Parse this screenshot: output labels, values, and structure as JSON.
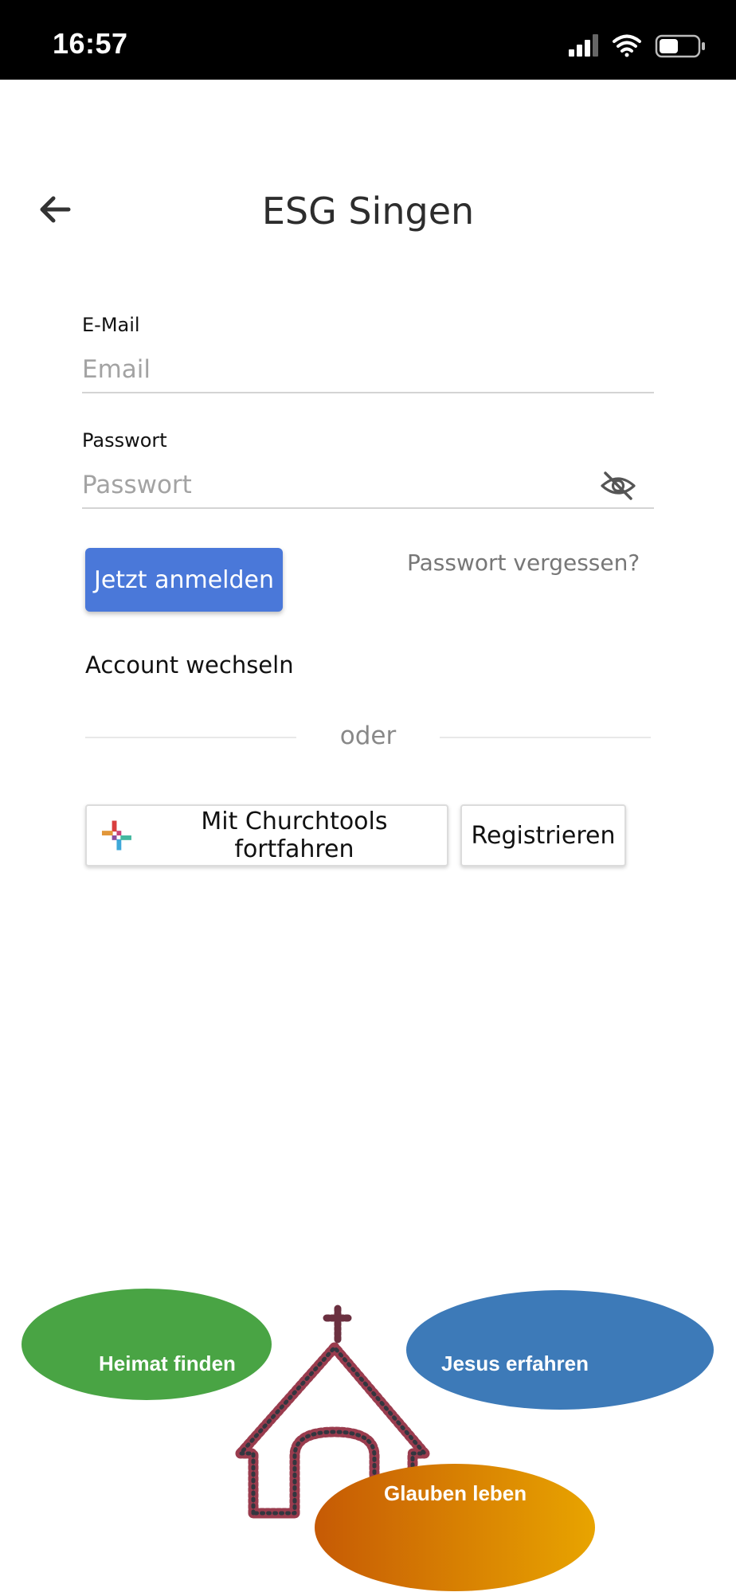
{
  "status_bar": {
    "time": "16:57",
    "icons": [
      "cellular-signal-icon",
      "wifi-icon",
      "battery-icon"
    ]
  },
  "header": {
    "back_icon": "arrow-left-icon",
    "title": "ESG Singen"
  },
  "login_form": {
    "email_label": "E-Mail",
    "email_placeholder": "Email",
    "email_value": "",
    "password_label": "Passwort",
    "password_placeholder": "Passwort",
    "password_value": "",
    "password_visibility_icon": "eye-off-icon",
    "submit_label": "Jetzt anmelden",
    "forgot_password_label": "Passwort vergessen?",
    "switch_account_label": "Account wechseln"
  },
  "divider": {
    "label": "oder"
  },
  "alt_actions": {
    "churchtools_label": "Mit Churchtools fortfahren",
    "churchtools_icon": "churchtools-logo-icon",
    "register_label": "Registrieren"
  },
  "banner": {
    "items": [
      {
        "label": "Heimat finden",
        "color": "#49a444"
      },
      {
        "label": "Jesus erfahren",
        "color": "#3d7ab8"
      },
      {
        "label": "Glauben leben",
        "color": "#e29a08"
      }
    ],
    "graphic": "church-of-people-icon"
  },
  "colors": {
    "primary_button": "#4a78d9",
    "status_bar": "#000000"
  }
}
